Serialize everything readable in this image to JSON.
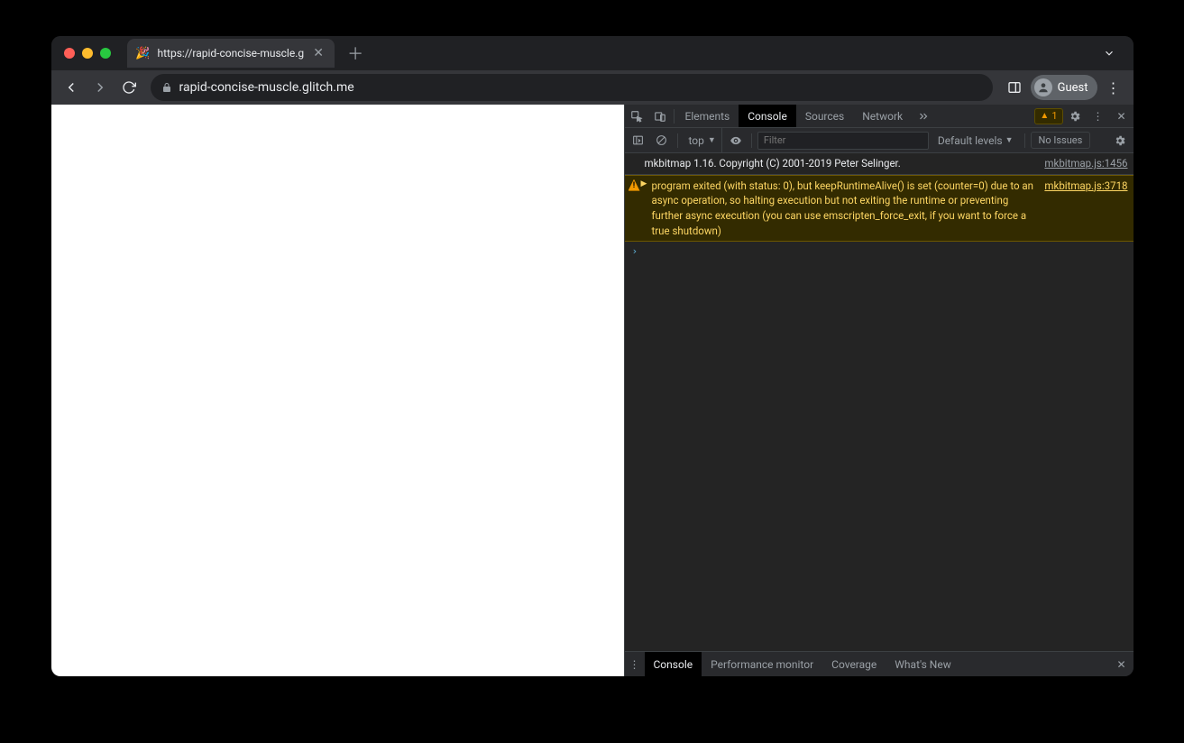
{
  "window": {
    "tab_title": "https://rapid-concise-muscle.g",
    "favicon": "🎉"
  },
  "toolbar": {
    "url": "rapid-concise-muscle.glitch.me",
    "profile_label": "Guest"
  },
  "devtools": {
    "tabs": {
      "elements": "Elements",
      "console": "Console",
      "sources": "Sources",
      "network": "Network"
    },
    "warn_count": "1",
    "console_toolbar": {
      "context": "top",
      "filter_placeholder": "Filter",
      "levels": "Default levels",
      "issues": "No Issues"
    },
    "messages": [
      {
        "type": "log",
        "text": "mkbitmap 1.16. Copyright (C) 2001-2019 Peter Selinger.",
        "source": "mkbitmap.js:1456"
      },
      {
        "type": "warn",
        "text": "program exited (with status: 0), but keepRuntimeAlive() is set (counter=0) due to an async operation, so halting execution but not exiting the runtime or preventing further async execution (you can use emscripten_force_exit, if you want to force a true shutdown)",
        "source": "mkbitmap.js:3718"
      }
    ],
    "drawer": {
      "console": "Console",
      "perf": "Performance monitor",
      "coverage": "Coverage",
      "whatsnew": "What's New"
    }
  }
}
